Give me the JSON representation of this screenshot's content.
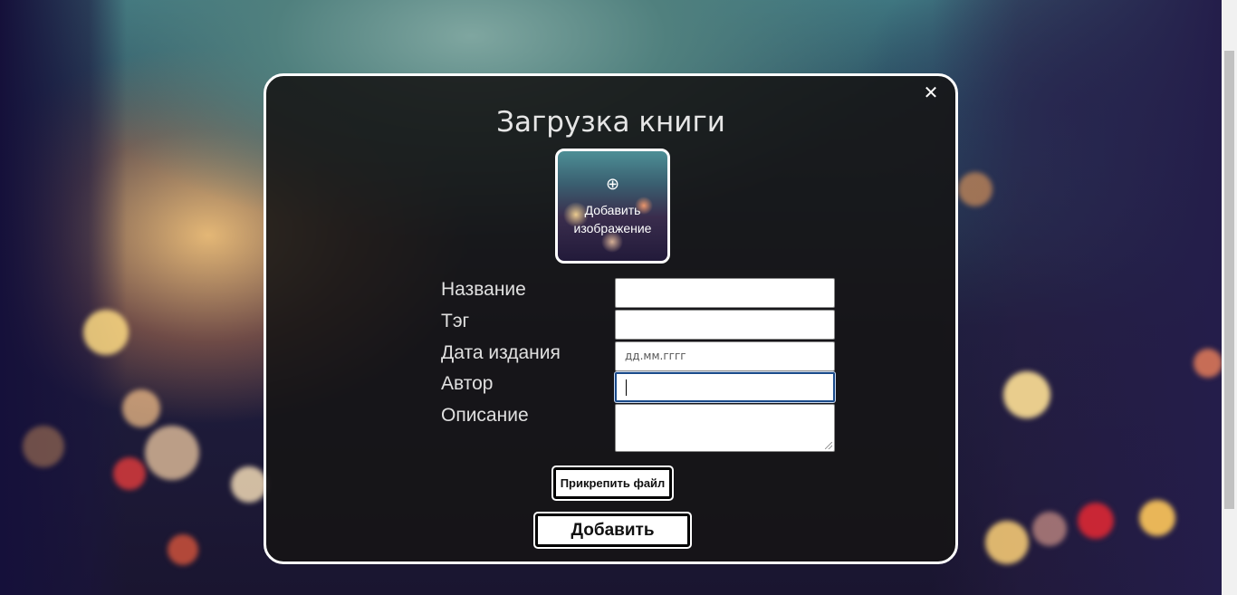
{
  "modal": {
    "title": "Загрузка книги",
    "close_icon": "close-icon",
    "image_upload": {
      "icon": "plus-circle-icon",
      "label": "Добавить изображение"
    },
    "fields": [
      {
        "label": "Название",
        "value": "",
        "placeholder": ""
      },
      {
        "label": "Тэг",
        "value": "",
        "placeholder": ""
      },
      {
        "label": "Дата издания",
        "value": "",
        "placeholder": "дд.мм.гггг"
      },
      {
        "label": "Автор",
        "value": "",
        "placeholder": ""
      },
      {
        "label": "Описание",
        "value": "",
        "placeholder": ""
      }
    ],
    "attach_button": "Прикрепить файл",
    "submit_button": "Добавить"
  }
}
